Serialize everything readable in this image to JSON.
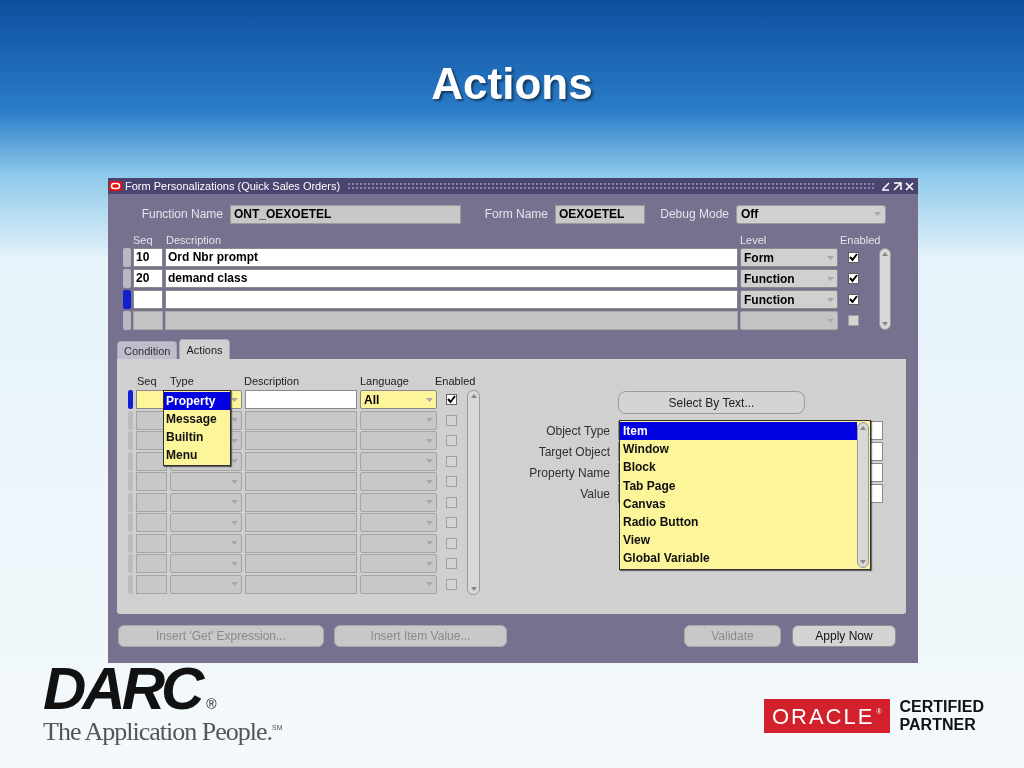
{
  "slide_title": "Actions",
  "window": {
    "title": "Form Personalizations (Quick Sales Orders)"
  },
  "header_fields": [
    {
      "label": "Function Name",
      "value": "ONT_OEXOETEL",
      "kind": "text"
    },
    {
      "label": "Form Name",
      "value": "OEXOETEL",
      "kind": "text"
    },
    {
      "label": "Debug Mode",
      "value": "Off",
      "kind": "select"
    }
  ],
  "rules_table": {
    "columns": [
      "Seq",
      "Description",
      "Level",
      "Enabled"
    ],
    "rows": [
      {
        "seq": "10",
        "description": "Ord Nbr prompt",
        "level": "Form",
        "enabled": true,
        "selected": false,
        "disabled": false
      },
      {
        "seq": "20",
        "description": "demand class",
        "level": "Function",
        "enabled": true,
        "selected": false,
        "disabled": false
      },
      {
        "level": "Function",
        "enabled": true,
        "selected": true,
        "disabled": false
      },
      {
        "enabled": false,
        "selected": false,
        "disabled": true
      }
    ]
  },
  "tabs": [
    {
      "label": "Condition",
      "selected": false
    },
    {
      "label": "Actions",
      "selected": true
    }
  ],
  "actions_table": {
    "columns": [
      "Seq",
      "Type",
      "Description",
      "Language",
      "Enabled"
    ],
    "rows": [
      {
        "language": "All",
        "enabled": true,
        "selected": true,
        "disabled": false
      },
      {
        "enabled": false,
        "selected": false,
        "disabled": true
      },
      {
        "enabled": false,
        "selected": false,
        "disabled": true
      },
      {
        "enabled": false,
        "selected": false,
        "disabled": true
      },
      {
        "enabled": false,
        "selected": false,
        "disabled": true
      },
      {
        "enabled": false,
        "selected": false,
        "disabled": true
      },
      {
        "enabled": false,
        "selected": false,
        "disabled": true
      },
      {
        "enabled": false,
        "selected": false,
        "disabled": true
      },
      {
        "enabled": false,
        "selected": false,
        "disabled": true
      },
      {
        "enabled": false,
        "selected": false,
        "disabled": true
      }
    ]
  },
  "type_dropdown": {
    "options": [
      {
        "label": "Property",
        "selected": true
      },
      {
        "label": "Message",
        "selected": false
      },
      {
        "label": "Builtin",
        "selected": false
      },
      {
        "label": "Menu",
        "selected": false
      }
    ]
  },
  "select_by_text_button": {
    "label": "Select By Text..."
  },
  "object_fields": [
    {
      "label": "Object Type"
    },
    {
      "label": "Target Object"
    },
    {
      "label": "Property Name"
    },
    {
      "label": "Value"
    }
  ],
  "object_type_dropdown": {
    "options": [
      {
        "label": "Item",
        "selected": true
      },
      {
        "label": "Window",
        "selected": false
      },
      {
        "label": "Block",
        "selected": false
      },
      {
        "label": "Tab Page",
        "selected": false
      },
      {
        "label": "Canvas",
        "selected": false
      },
      {
        "label": "Radio Button",
        "selected": false
      },
      {
        "label": "View",
        "selected": false
      },
      {
        "label": "Global Variable",
        "selected": false
      }
    ]
  },
  "buttons": [
    {
      "label": "Insert 'Get' Expression...",
      "disabled": true
    },
    {
      "label": "Insert Item Value...",
      "disabled": true
    },
    {
      "label": "Validate",
      "disabled": true
    },
    {
      "label": "Apply Now",
      "disabled": false
    }
  ],
  "darc_logo": {
    "wordmark": "DARC",
    "registered": "®",
    "tagline": "The Application People.",
    "service_mark": "SM"
  },
  "oracle_badge": {
    "wordmark": "ORACLE",
    "registered": "®",
    "caption_lines": [
      "CERTIFIED",
      "PARTNER"
    ]
  }
}
